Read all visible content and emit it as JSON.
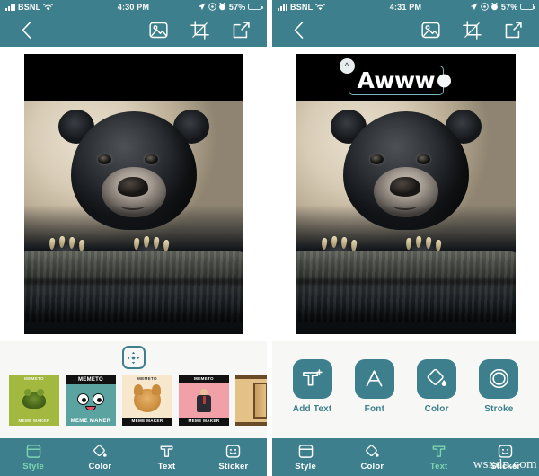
{
  "app": {
    "name": "Meme Maker",
    "accent": "#3d7f8c",
    "active_accent": "#7fd4b0",
    "panel_bg": "#f7f8f6"
  },
  "watermark": "wsxdn.com",
  "screens": [
    {
      "id": "style-screen",
      "status_bar": {
        "carrier": "BSNL",
        "time": "4:30 PM",
        "battery_percent": "57%",
        "signal_icon": "cellular-signal-icon",
        "wifi_icon": "wifi-icon",
        "location_icon": "location-arrow-icon",
        "rotation_lock_icon": "rotation-lock-icon",
        "alarm_icon": "alarm-clock-icon",
        "battery_icon": "battery-icon"
      },
      "top_bar": {
        "back_icon": "chevron-left-icon",
        "gallery_icon": "image-picker-icon",
        "crop_icon": "crop-icon",
        "share_icon": "share-export-icon"
      },
      "canvas": {
        "caption": "",
        "has_text_object": false
      },
      "panel": {
        "type": "style",
        "fit_button_icon": "move-resize-icon",
        "templates": [
          {
            "name": "frog-template",
            "top": "MEMETO",
            "bottom": "MEME MAKER",
            "art": "frog",
            "selected": false
          },
          {
            "name": "mememaker-face-template",
            "top": "MEMETO",
            "bottom": "MEME MAKER",
            "art": "face",
            "selected": true
          },
          {
            "name": "doge-template",
            "top": "MEMETO",
            "bottom": "MEME MAKER",
            "art": "doge",
            "selected": false
          },
          {
            "name": "suit-guy-template",
            "top": "MEMETO",
            "bottom": "MEME MAKER",
            "art": "suit",
            "selected": false
          },
          {
            "name": "plank-template",
            "top": "",
            "bottom": "",
            "art": "plank",
            "selected": false
          }
        ]
      },
      "bottom_nav": [
        {
          "label": "Style",
          "icon": "style-frame-icon",
          "active": true
        },
        {
          "label": "Color",
          "icon": "paint-bucket-icon",
          "active": false
        },
        {
          "label": "Text",
          "icon": "text-tool-icon",
          "active": false
        },
        {
          "label": "Sticker",
          "icon": "smiley-sticker-icon",
          "active": false
        }
      ]
    },
    {
      "id": "text-screen",
      "status_bar": {
        "carrier": "BSNL",
        "time": "4:31 PM",
        "battery_percent": "57%",
        "signal_icon": "cellular-signal-icon",
        "wifi_icon": "wifi-icon",
        "location_icon": "location-arrow-icon",
        "rotation_lock_icon": "rotation-lock-icon",
        "alarm_icon": "alarm-clock-icon",
        "battery_icon": "battery-icon"
      },
      "top_bar": {
        "back_icon": "chevron-left-icon",
        "gallery_icon": "image-picker-icon",
        "crop_icon": "crop-icon",
        "share_icon": "share-export-icon"
      },
      "canvas": {
        "caption": "Awww",
        "has_text_object": true,
        "rotate_handle_icon": "rotate-handle-icon",
        "resize_handle_icon": "resize-handle-icon"
      },
      "panel": {
        "type": "text-tools",
        "tools": [
          {
            "label": "Add Text",
            "icon": "add-text-icon"
          },
          {
            "label": "Font",
            "icon": "font-icon"
          },
          {
            "label": "Color",
            "icon": "paint-bucket-icon"
          },
          {
            "label": "Stroke",
            "icon": "stroke-ring-icon"
          }
        ]
      },
      "bottom_nav": [
        {
          "label": "Style",
          "icon": "style-frame-icon",
          "active": false
        },
        {
          "label": "Color",
          "icon": "paint-bucket-icon",
          "active": false
        },
        {
          "label": "Text",
          "icon": "text-tool-icon",
          "active": true
        },
        {
          "label": "Sticker",
          "icon": "smiley-sticker-icon",
          "active": false
        }
      ]
    }
  ]
}
